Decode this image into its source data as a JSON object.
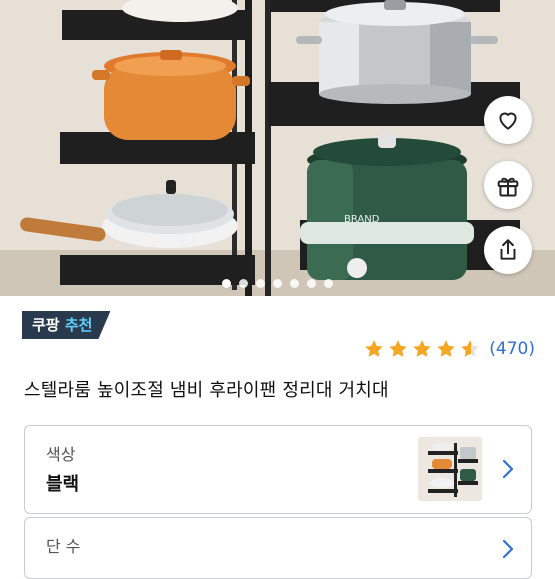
{
  "badge": {
    "brand": "쿠팡",
    "accent": "추천"
  },
  "rating": {
    "stars": 4.5,
    "max": 5,
    "count_text": "(470)"
  },
  "product": {
    "title": "스텔라룸 높이조절 냄비 후라이팬 정리대 거치대"
  },
  "options": [
    {
      "label": "색상",
      "value": "블랙"
    },
    {
      "label": "단 수"
    }
  ],
  "image": {
    "brand_text": "BRAND"
  },
  "carousel": {
    "total": 7,
    "active": 0
  },
  "actions": [
    "heart-icon",
    "gift-icon",
    "share-icon"
  ],
  "colors": {
    "badge_bg": "#2a3a4e",
    "badge_accent": "#5fd0ff",
    "star": "#f5a623",
    "count": "#2f6fd6",
    "chevron": "#2f6fd6"
  }
}
